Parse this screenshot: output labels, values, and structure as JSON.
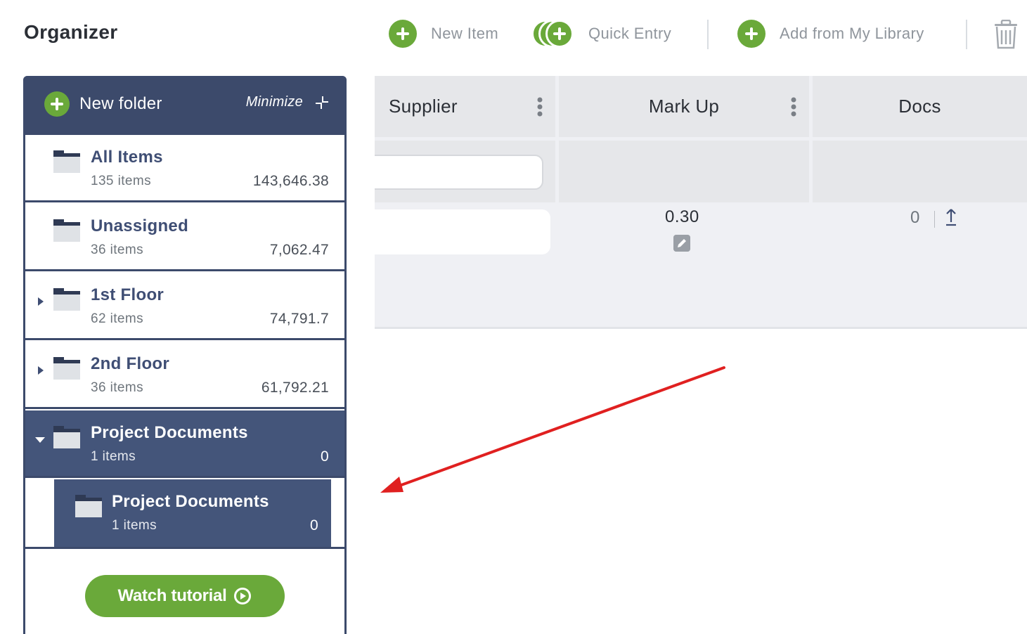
{
  "header": {
    "title": "Organizer",
    "new_item": "New Item",
    "quick_entry": "Quick Entry",
    "add_from_library": "Add from My Library"
  },
  "sidebar": {
    "new_folder": "New folder",
    "minimize": "Minimize",
    "folders": [
      {
        "name": "All Items",
        "count": "135 items",
        "value": "143,646.38"
      },
      {
        "name": "Unassigned",
        "count": "36 items",
        "value": "7,062.47"
      },
      {
        "name": "1st Floor",
        "count": "62 items",
        "value": "74,791.7"
      },
      {
        "name": "2nd Floor",
        "count": "36 items",
        "value": "61,792.21"
      },
      {
        "name": "Project Documents",
        "count": "1 items",
        "value": "0"
      }
    ],
    "subfolder": {
      "name": "Project Documents",
      "count": "1 items",
      "value": "0"
    },
    "tutorial": "Watch tutorial"
  },
  "table": {
    "columns": [
      "Supplier",
      "Mark Up",
      "Docs"
    ],
    "row": {
      "mark_up": "0.30",
      "docs_count": "0"
    }
  },
  "colors": {
    "accent_green": "#6aa93a",
    "navy": "#3c4a6b",
    "selected_navy": "#44557a",
    "annotation_red": "#e02020"
  }
}
